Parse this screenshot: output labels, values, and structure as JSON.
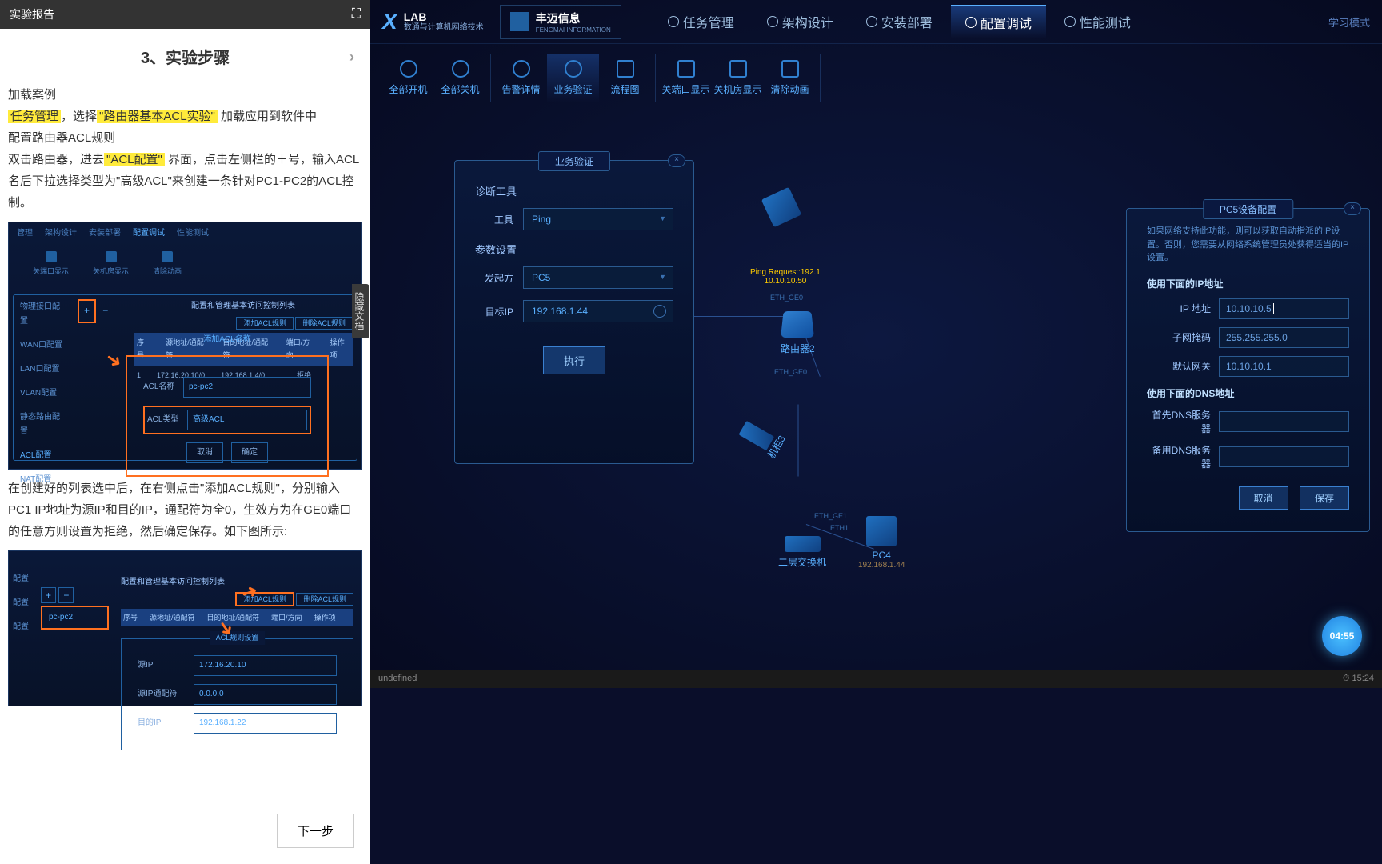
{
  "doc": {
    "header": "实验报告",
    "title": "3、实验步骤",
    "p1": "加载案例",
    "p2a": "任务管理",
    "p2b": "，选择",
    "p2c": "\"路由器基本ACL实验\"",
    "p2d": " 加载应用到软件中",
    "p3": "配置路由器ACL规则",
    "p4a": "双击路由器，进去",
    "p4b": "\"ACL配置\"",
    "p4c": " 界面，点击左侧栏的＋号，输入ACL名后下拉选择类型为\"高级ACL\"来创建一条针对PC1-PC2的ACL控制。",
    "p5": "在创建好的列表选中后，在右侧点击\"添加ACL规则\"，分别输入PC1 IP地址为源IP和目的IP，通配符为全0，生效方为在GE0端口的任意方则设置为拒绝，然后确定保存。如下图所示:",
    "hide_tab": "隐藏文档",
    "next": "下一步"
  },
  "ss1": {
    "nav": [
      "管理",
      "架构设计",
      "安装部署",
      "配置调试",
      "性能测试"
    ],
    "tools": [
      "关端口显示",
      "关机房显示",
      "清除动画"
    ],
    "sidebar": [
      "物理接口配置",
      "WAN口配置",
      "LAN口配置",
      "VLAN配置",
      "静态路由配置",
      "ACL配置",
      "NAT配置"
    ],
    "table_title": "配置和管理基本访问控制列表",
    "btn_add": "添加ACL规则",
    "btn_del": "删除ACL规则",
    "th": [
      "序号",
      "源地址/通配符",
      "目的地址/通配符",
      "端口/方向",
      "操作项"
    ],
    "row": [
      "1",
      "172.16.20.10/0",
      "192.168.1.4/0",
      "",
      "拒绝"
    ],
    "dialog_title": "添加ACL名称",
    "acl_name_label": "ACL名称",
    "acl_name_val": "pc-pc2",
    "acl_type_label": "ACL类型",
    "acl_type_val": "高级ACL",
    "cancel": "取消",
    "ok": "确定"
  },
  "ss2": {
    "sidebar": [
      "配置",
      "配置",
      "配置"
    ],
    "selected": "pc-pc2",
    "table_title": "配置和管理基本访问控制列表",
    "btn_add": "添加ACL规则",
    "btn_del": "删除ACL规则",
    "th": [
      "序号",
      "源地址/通配符",
      "目的地址/通配符",
      "端口/方向",
      "操作项"
    ],
    "dialog_title": "ACL规则设置",
    "src_ip_label": "源IP",
    "src_ip": "172.16.20.10",
    "src_mask_label": "源IP通配符",
    "src_mask": "0.0.0.0",
    "dst_ip_label": "目的IP",
    "dst_ip": "192.168.1.22"
  },
  "header": {
    "lab": "LAB",
    "sub": "数通与计算机网络技术",
    "brand_cn": "丰迈信息",
    "brand_en": "FENGMAI INFORMATION",
    "nav": [
      "任务管理",
      "架构设计",
      "安装部署",
      "配置调试",
      "性能测试"
    ],
    "study": "学习模式"
  },
  "toolbar": {
    "items": [
      "全部开机",
      "全部关机",
      "告警详情",
      "业务验证",
      "流程图",
      "关端口显示",
      "关机房显示",
      "清除动画"
    ]
  },
  "diag": {
    "title": "业务验证",
    "section1": "诊断工具",
    "tool_label": "工具",
    "tool_val": "Ping",
    "section2": "参数设置",
    "sender_label": "发起方",
    "sender_val": "PC5",
    "target_label": "目标IP",
    "target_val": "192.168.1.44",
    "exec": "执行"
  },
  "topo": {
    "ping_text": "Ping Request:192.1",
    "ping_ip": "10.10.10.50",
    "eth_ge0a": "ETH_GE0",
    "router2": "路由器2",
    "eth_ge0b": "ETH_GE0",
    "rack3": "机柜3",
    "eth_ge1": "ETH_GE1",
    "eth1": "ETH1",
    "switch": "二层交换机",
    "pc4": "PC4",
    "pc4_ip": "192.168.1.44"
  },
  "pc_cfg": {
    "title": "PC5设备配置",
    "notice": "如果网络支持此功能，则可以获取自动指派的IP设置。否则，您需要从网络系统管理员处获得适当的IP设置。",
    "sec1": "使用下面的IP地址",
    "ip_label": "IP 地址",
    "ip_val": "10.10.10.5",
    "mask_label": "子网掩码",
    "mask_val": "255.255.255.0",
    "gw_label": "默认网关",
    "gw_val": "10.10.10.1",
    "sec2": "使用下面的DNS地址",
    "dns1_label": "首先DNS服务器",
    "dns2_label": "备用DNS服务器",
    "cancel": "取消",
    "save": "保存"
  },
  "status": {
    "left": "undefined",
    "time": "15:24"
  },
  "timer": "04:55"
}
